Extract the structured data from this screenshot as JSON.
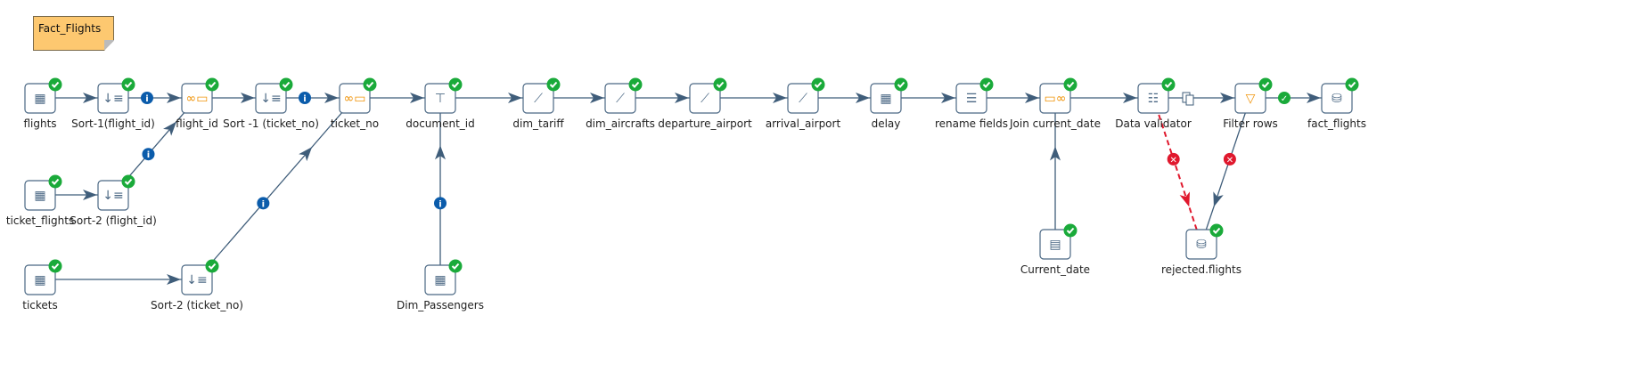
{
  "note": {
    "text": "Fact_Flights"
  },
  "colors": {
    "hop": "#3f5d7a",
    "ok": "#1aaa3a",
    "info": "#0b5cab",
    "error": "#e0182d",
    "note": "#fdc870",
    "icon_border": "#4b6884"
  },
  "steps": [
    {
      "id": "flights",
      "label": "flights",
      "icon": "table-input-icon"
    },
    {
      "id": "sort1f",
      "label": "Sort-1(flight_id)",
      "icon": "sort-icon"
    },
    {
      "id": "flight_id",
      "label": "flight_id",
      "icon": "merge-join-icon"
    },
    {
      "id": "sort1t",
      "label": "Sort -1 (ticket_no)",
      "icon": "sort-icon"
    },
    {
      "id": "ticket_no",
      "label": "ticket_no",
      "icon": "merge-join-icon"
    },
    {
      "id": "document_id",
      "label": "document_id",
      "icon": "dimension-lookup-icon"
    },
    {
      "id": "dim_tariff",
      "label": "dim_tariff",
      "icon": "lookup-chart-icon"
    },
    {
      "id": "dim_aircrafts",
      "label": "dim_aircrafts",
      "icon": "lookup-chart-icon"
    },
    {
      "id": "departure_airport",
      "label": "departure_airport",
      "icon": "lookup-chart-icon"
    },
    {
      "id": "arrival_airport",
      "label": "arrival_airport",
      "icon": "lookup-chart-icon"
    },
    {
      "id": "delay",
      "label": "delay",
      "icon": "calculator-icon"
    },
    {
      "id": "rename",
      "label": "rename fields",
      "icon": "select-values-icon"
    },
    {
      "id": "joincd",
      "label": "Join current_date",
      "icon": "join-rows-icon"
    },
    {
      "id": "validator",
      "label": "Data validator",
      "icon": "data-validator-icon"
    },
    {
      "id": "filter",
      "label": "Filter rows",
      "icon": "filter-icon"
    },
    {
      "id": "fact_flights",
      "label": "fact_flights",
      "icon": "table-output-icon"
    },
    {
      "id": "ticket_flights",
      "label": "ticket_flights",
      "icon": "table-input-icon"
    },
    {
      "id": "sort2f",
      "label": "Sort-2 (flight_id)",
      "icon": "sort-icon"
    },
    {
      "id": "tickets",
      "label": "tickets",
      "icon": "table-input-icon"
    },
    {
      "id": "sort2t",
      "label": "Sort-2 (ticket_no)",
      "icon": "sort-icon"
    },
    {
      "id": "dim_passengers",
      "label": "Dim_Passengers",
      "icon": "table-input-icon"
    },
    {
      "id": "current_date",
      "label": "Current_date",
      "icon": "system-info-icon"
    },
    {
      "id": "rejected",
      "label": "rejected.flights",
      "icon": "table-output-icon"
    }
  ],
  "hops": [
    {
      "from": "flights",
      "to": "sort1f",
      "badge": ""
    },
    {
      "from": "sort1f",
      "to": "flight_id",
      "badge": "info"
    },
    {
      "from": "flight_id",
      "to": "sort1t",
      "badge": ""
    },
    {
      "from": "sort1t",
      "to": "ticket_no",
      "badge": "info"
    },
    {
      "from": "ticket_no",
      "to": "document_id",
      "badge": ""
    },
    {
      "from": "document_id",
      "to": "dim_tariff",
      "badge": ""
    },
    {
      "from": "dim_tariff",
      "to": "dim_aircrafts",
      "badge": ""
    },
    {
      "from": "dim_aircrafts",
      "to": "departure_airport",
      "badge": ""
    },
    {
      "from": "departure_airport",
      "to": "arrival_airport",
      "badge": ""
    },
    {
      "from": "arrival_airport",
      "to": "delay",
      "badge": ""
    },
    {
      "from": "delay",
      "to": "rename",
      "badge": ""
    },
    {
      "from": "rename",
      "to": "joincd",
      "badge": ""
    },
    {
      "from": "joincd",
      "to": "validator",
      "badge": ""
    },
    {
      "from": "validator",
      "to": "filter",
      "badge": "copy"
    },
    {
      "from": "filter",
      "to": "fact_flights",
      "badge": "ok"
    },
    {
      "from": "ticket_flights",
      "to": "sort2f",
      "badge": ""
    },
    {
      "from": "sort2f",
      "to": "flight_id",
      "badge": "info"
    },
    {
      "from": "tickets",
      "to": "sort2t",
      "badge": ""
    },
    {
      "from": "sort2t",
      "to": "ticket_no",
      "badge": "info"
    },
    {
      "from": "dim_passengers",
      "to": "document_id",
      "badge": "info"
    },
    {
      "from": "current_date",
      "to": "joincd",
      "badge": ""
    },
    {
      "from": "validator",
      "to": "rejected",
      "badge": "error",
      "dashed": true
    },
    {
      "from": "filter",
      "to": "rejected",
      "badge": "error"
    }
  ]
}
